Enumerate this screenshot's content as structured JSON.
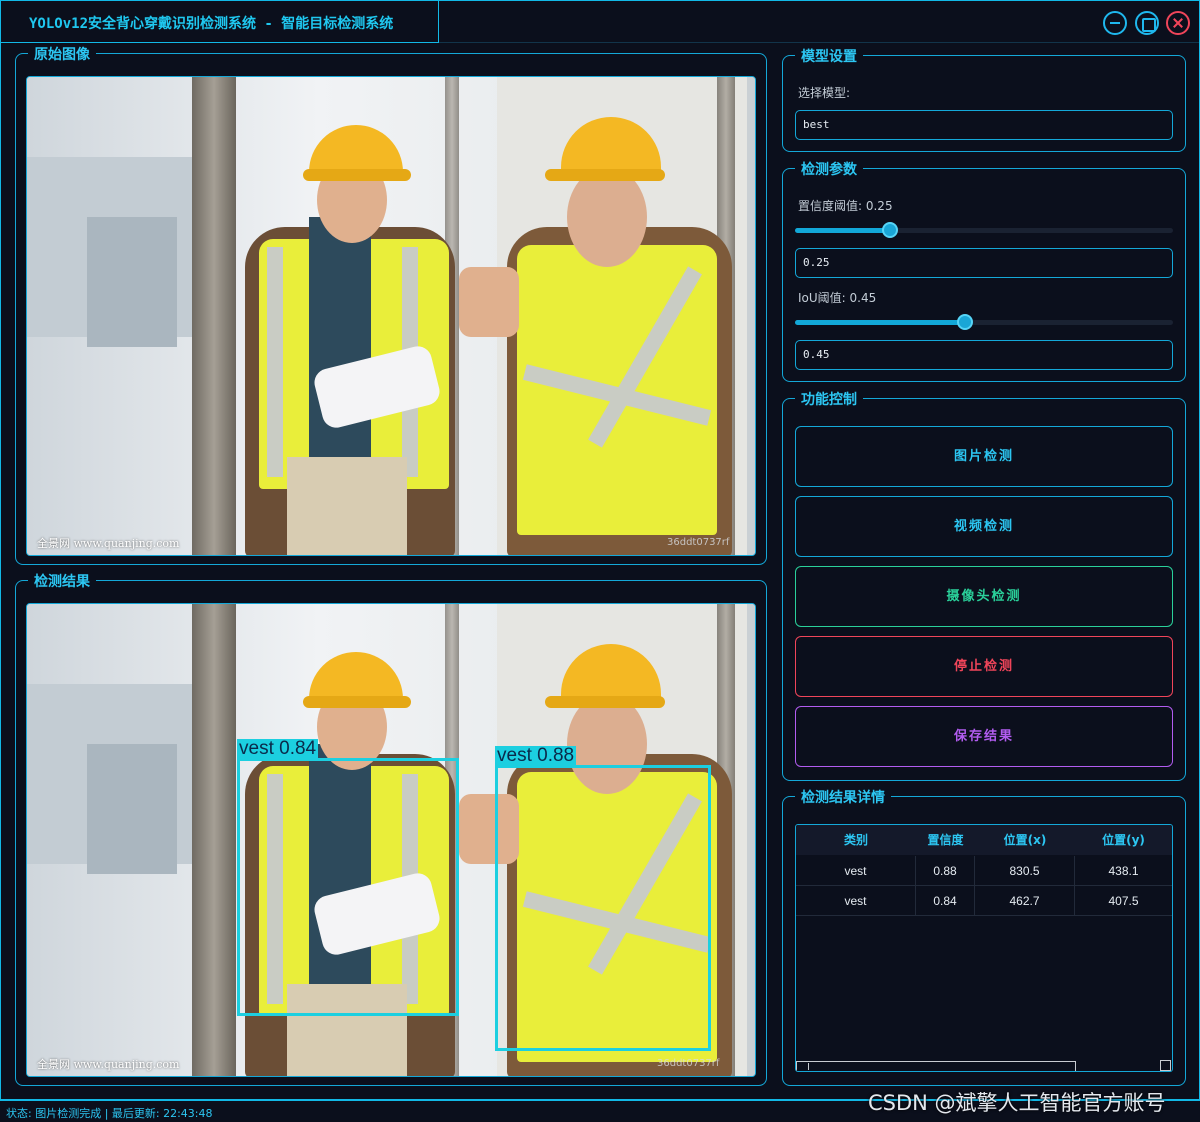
{
  "window": {
    "title": "YOLOv12安全背心穿戴识别检测系统 - 智能目标检测系统"
  },
  "panels": {
    "original_title": "原始图像",
    "result_title": "检测结果"
  },
  "image": {
    "watermark_left": "全景网 www.quanjing.com",
    "watermark_right": "36ddt0737rf"
  },
  "detections": [
    {
      "label": "vest 0.84"
    },
    {
      "label": "vest 0.88"
    }
  ],
  "model": {
    "title": "模型设置",
    "select_label": "选择模型:",
    "selected": "best"
  },
  "params": {
    "title": "检测参数",
    "conf_label": "置信度阈值: 0.25",
    "conf_value": "0.25",
    "conf_level": 0.25,
    "iou_label": "IoU阈值: 0.45",
    "iou_value": "0.45",
    "iou_level": 0.45
  },
  "controls": {
    "title": "功能控制",
    "image_detect": "图片检测",
    "video_detect": "视频检测",
    "camera_detect": "摄像头检测",
    "stop_detect": "停止检测",
    "save_result": "保存结果"
  },
  "results": {
    "title": "检测结果详情",
    "columns": [
      "类别",
      "置信度",
      "位置(x)",
      "位置(y)"
    ],
    "rows": [
      [
        "vest",
        "0.88",
        "830.5",
        "438.1"
      ],
      [
        "vest",
        "0.84",
        "462.7",
        "407.5"
      ]
    ]
  },
  "status": {
    "text": "状态: 图片检测完成 | 最后更新: 22:43:48"
  },
  "overlay": {
    "credit": "CSDN @斌擎人工智能官方账号"
  },
  "colors": {
    "accent": "#12b8e6",
    "camera_button": "#2ad09a",
    "stop_button": "#f0455a",
    "save_button": "#b25cf0",
    "detection_box": "#1ccfe0"
  }
}
